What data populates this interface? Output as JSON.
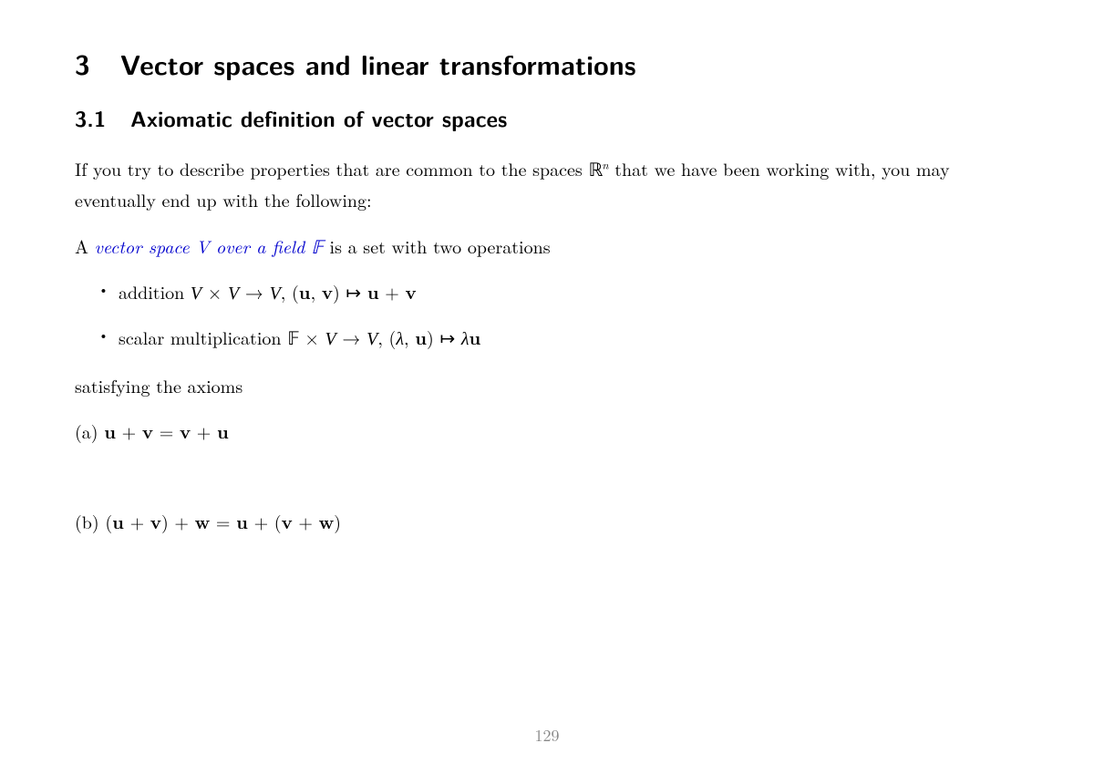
{
  "section": {
    "number": "3",
    "title": "Vector spaces and linear transformations"
  },
  "subsection": {
    "number": "3.1",
    "title": "Axiomatic definition of vector spaces"
  },
  "intro_part1": "If you try to describe properties that are common to the spaces ",
  "intro_rn_R": "ℝ",
  "intro_rn_sup": "n",
  "intro_part2": " that we have been working with, you may eventually end up with the following:",
  "def_lead": "A ",
  "def_blue": "vector space V  over a field 𝔽",
  "def_tail": " is a set with two operations",
  "op_add": {
    "label": "addition ",
    "V": "V",
    "times": " × ",
    "arrow": " → ",
    "comma_open": ", (",
    "u": "u",
    "sep": ", ",
    "v": "v",
    "close": ")",
    "mapsto": " ↦ ",
    "plus": " + "
  },
  "op_scal": {
    "label": "scalar multiplication ",
    "F": "𝔽",
    "times": " × ",
    "V": "V",
    "arrow": " → ",
    "comma_open": ", (",
    "lambda": "λ",
    "sep": ", ",
    "u": "u",
    "close": ")",
    "mapsto": " ↦ "
  },
  "satisfying": "satisfying the axioms",
  "axiom_a": {
    "label": "(a) ",
    "u": "u",
    "plus": " + ",
    "v": "v",
    "eq": " = "
  },
  "axiom_b": {
    "label": "(b) ",
    "open": "(",
    "u": "u",
    "plus": " + ",
    "v": "v",
    "close": ")",
    "w": "w",
    "eq": " = "
  },
  "page_number": "129"
}
